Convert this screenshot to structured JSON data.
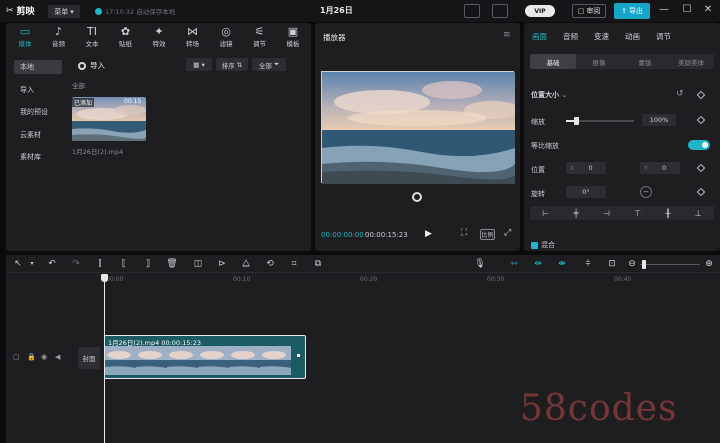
{
  "app": {
    "name": "剪映",
    "menu_label": "菜单",
    "autosave": "17:10:32 自动保存本地",
    "project_title": "1月26日"
  },
  "topbar": {
    "vip": "VIP",
    "share": "审阅",
    "export": "导出",
    "minimize": "—",
    "maximize": "☐",
    "close": "✕"
  },
  "media_tabs": [
    {
      "label": "媒体",
      "icon": "▭"
    },
    {
      "label": "音频",
      "icon": "♪"
    },
    {
      "label": "文本",
      "icon": "TI"
    },
    {
      "label": "贴纸",
      "icon": "✿"
    },
    {
      "label": "特效",
      "icon": "✦"
    },
    {
      "label": "转场",
      "icon": "⋈"
    },
    {
      "label": "滤镜",
      "icon": "◎"
    },
    {
      "label": "调节",
      "icon": "⚟"
    },
    {
      "label": "模板",
      "icon": "▣"
    }
  ],
  "media_sidebar": [
    "本地",
    "导入",
    "我的预设",
    "云素材",
    "素材库"
  ],
  "media": {
    "import_label": "导入",
    "sort_label": "排序",
    "all_filter": "全部",
    "all_header": "全部",
    "added_badge": "已添加",
    "thumb_duration": "00:15",
    "thumb_name": "1月26日(2).mp4"
  },
  "player": {
    "title": "播放器",
    "time_current": "00:00:00:00",
    "time_total": "00:00:15:23",
    "ratio": "比例"
  },
  "props": {
    "tabs": [
      "画面",
      "音频",
      "变速",
      "动画",
      "调节"
    ],
    "subtabs": [
      "基础",
      "抠像",
      "蒙版",
      "美颜美体"
    ],
    "section_title": "位置大小",
    "scale_label": "缩放",
    "scale_value": "100%",
    "scale_fraction": 0.15,
    "uniform_label": "等比缩放",
    "position_label": "位置",
    "pos_x_prefix": "X",
    "pos_x": "0",
    "pos_y_prefix": "Y",
    "pos_y": "0",
    "rotate_label": "旋转",
    "rotate_value": "0°",
    "blend_label": "混合"
  },
  "timeline": {
    "ruler_labels": [
      "00:00",
      "00:10",
      "00:20",
      "00:30",
      "00:40"
    ],
    "cover_label": "封面",
    "clip_label": "1月26日(2).mp4   00:00:15:23"
  },
  "colors": {
    "accent": "#1fb5c4",
    "panel": "#1e1e21",
    "background": "#0b0b0d",
    "clip": "#1b5c64"
  },
  "watermark": "58codes"
}
